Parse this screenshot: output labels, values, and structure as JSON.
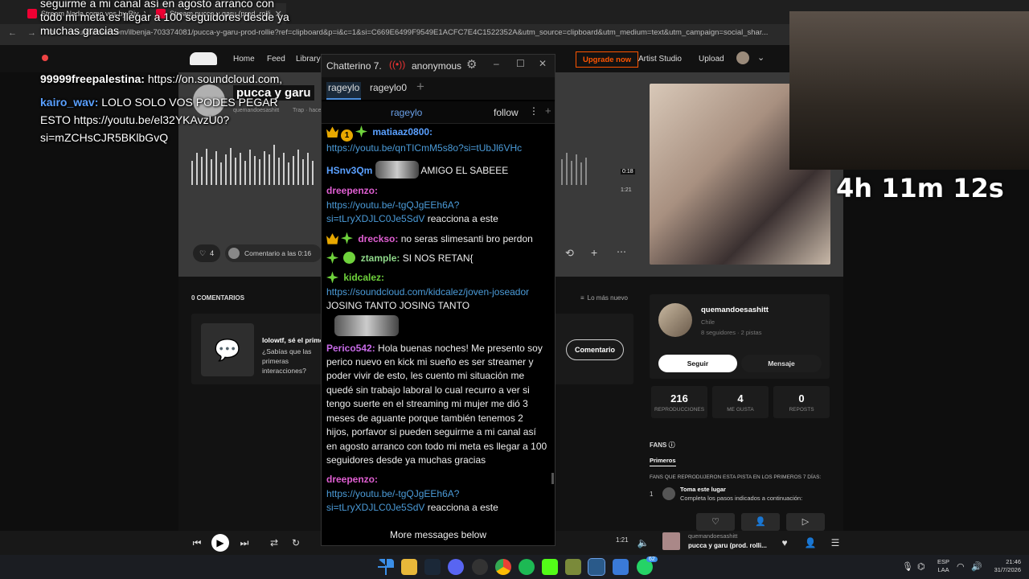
{
  "browser": {
    "tabs": [
      {
        "label": "Stream Nada como vos by Riv"
      },
      {
        "label": "Stream pucca y garu (prod. rolli"
      }
    ],
    "url": "soundcloud.com/ilbenja-703374081/pucca-y-garu-prod-rollie?ref=clipboard&p=i&c=1&si=C669E6499F9549E1ACFC7E4C1522352A&utm_source=clipboard&utm_medium=text&utm_campaign=social_shar..."
  },
  "soundcloud": {
    "nav": {
      "home": "Home",
      "feed": "Feed",
      "library": "Library",
      "upgrade": "Upgrade now",
      "artist_studio": "Artist Studio",
      "upload": "Upload"
    },
    "track": {
      "title": "pucca y garu",
      "artist": "quemandoesashitt",
      "tags": "Trap · hace 18 días",
      "time_current": "0:18",
      "time_total": "1:21"
    },
    "actions": {
      "likes": "4",
      "comment_placeholder": "Comentario a las 0:16"
    },
    "comments_header": "0 COMENTARIOS",
    "sort": "Lo más nuevo",
    "empty_comment": {
      "title": "lolowtf, sé el primero",
      "body": "¿Sabías que las primeras interacciones?",
      "button": "Comentario"
    },
    "profile": {
      "name": "quemandoesashitt",
      "country": "Chile",
      "followers": "8 seguidores · 2 pistas",
      "follow": "Seguir",
      "message": "Mensaje"
    },
    "stats": [
      {
        "value": "216",
        "label": "REPRODUCCIONES"
      },
      {
        "value": "4",
        "label": "ME GUSTA"
      },
      {
        "value": "0",
        "label": "REPOSTS"
      }
    ],
    "fans": {
      "title": "FANS",
      "tab": "Primeros",
      "subtitle": "FANS QUE REPRODUJERON ESTA PISTA EN LOS PRIMEROS 7 DÍAS:",
      "rank": "1",
      "item_title": "Toma este lugar",
      "item_body": "Completa los pasos indicados a continuación:"
    },
    "player": {
      "time": "1:21",
      "artist": "quemandoesashitt",
      "track": "pucca y garu (prod. rolli..."
    }
  },
  "chatterino": {
    "title": "Chatterino 7.",
    "user": "anonymous",
    "tabs": [
      "rageylo",
      "rageylo0"
    ],
    "channel": "rageylo",
    "follow": "follow",
    "messages": [
      {
        "user": "matiaaz0800:",
        "text": "https://youtu.be/qnTICmM5s8o?si=tUbJl6VHc"
      },
      {
        "user": "HSnv3Qm",
        "text": "AMIGO EL SABEEE"
      },
      {
        "user": "dreepenzo:",
        "link": "https://youtu.be/-tgQJgEEh6A?si=tLryXDJLC0Je5SdV",
        "text": "reacciona a este"
      },
      {
        "user": "drecks​o:",
        "text": "no seras slimesanti bro perdon"
      },
      {
        "user": "ztample:",
        "text": "SI NOS RETAN{"
      },
      {
        "user": "kidcalez:",
        "link": "https://soundcloud.com/kidcalez/joven-joseador",
        "text": "JOSING TANTO JOSING TANTO"
      },
      {
        "user": "Perico542:",
        "text": "Hola buenas noches! Me presento soy perico nuevo en kick mi sueño es ser streamer y poder vivir de esto, les cuento mi situación me quedé sin trabajo laboral lo cual recurro a ver si tengo suerte en el streaming mi mujer me dió 3 meses de aguante porque también tenemos 2 hijos, porfavor si pueden seguirme a mi canal así en agosto arranco con todo mi meta es llegar a 100 seguidores desde ya muchas gracias"
      },
      {
        "user": "dreepenzo:",
        "link": "https://youtu.be/-tgQJgEEh6A?si=tLryXDJLC0Je5SdV",
        "text": "reacciona a este"
      }
    ],
    "more": "More messages below"
  },
  "overlay": {
    "top_text": "seguirme a mi canal así en agosto arranco con todo mi meta es llegar a 100 seguidores desde ya muchas gracias",
    "lines": [
      {
        "user": "99999freepalestina:",
        "text": "https://on.soundcloud.com,"
      },
      {
        "user": "kairo_wav:",
        "text": "LOLO SOLO VOS PODES PEGAR ESTO https://youtu.be/el32YKAvzU0?si=mZCHsCJR5BKlbGvQ"
      }
    ],
    "timer": "4h 11m 12s"
  },
  "taskbar": {
    "lang": "ESP",
    "region": "LAA",
    "time": "21:46",
    "date": "31/7/2026",
    "badge": "62"
  }
}
